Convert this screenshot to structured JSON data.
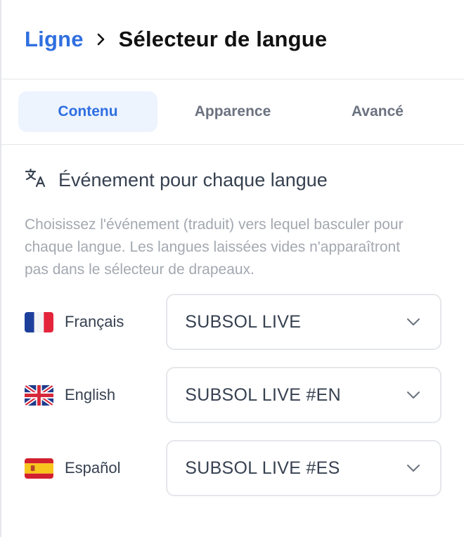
{
  "header": {
    "parent_label": "Ligne",
    "current_label": "Sélecteur de langue"
  },
  "tabs": [
    {
      "label": "Contenu",
      "active": true
    },
    {
      "label": "Apparence",
      "active": false
    },
    {
      "label": "Avancé",
      "active": false
    }
  ],
  "section": {
    "icon": "translate-icon",
    "title": "Événement pour chaque langue",
    "description": "Choisissez l'événement (traduit) vers lequel basculer pour chaque langue. Les langues laissées vides n'apparaîtront pas dans le sélecteur de drapeaux."
  },
  "languages": [
    {
      "label": "Français",
      "flag": "flag-france-icon",
      "selected": "SUBSOL LIVE"
    },
    {
      "label": "English",
      "flag": "flag-uk-icon",
      "selected": "SUBSOL LIVE #EN"
    },
    {
      "label": "Español",
      "flag": "flag-spain-icon",
      "selected": "SUBSOL LIVE #ES"
    }
  ],
  "colors": {
    "accent": "#2f6fe0",
    "active_tab_bg": "#edf4fe",
    "border": "#e5e7eb",
    "muted_text": "#a3a8b0"
  }
}
